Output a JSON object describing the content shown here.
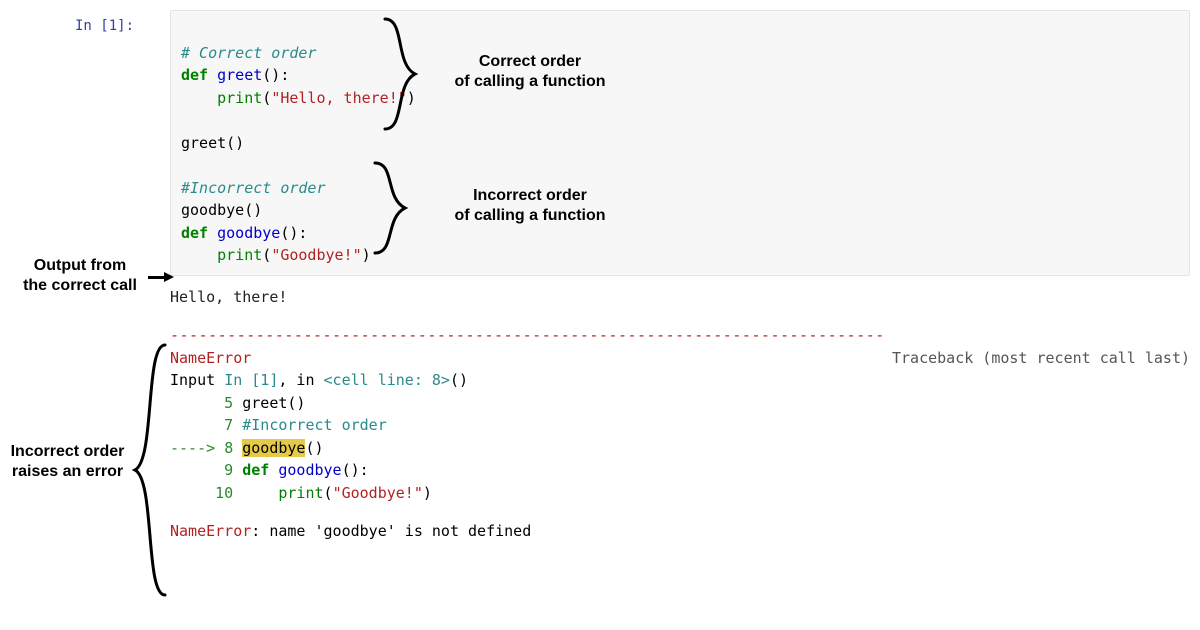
{
  "prompt": "In [1]:",
  "code": {
    "l1_comment": "# Correct order",
    "l2_kw": "def",
    "l2_fn": "greet",
    "l2_rest": "():",
    "l3_indent": "    ",
    "l3_builtin": "print",
    "l3_open": "(",
    "l3_str": "\"Hello, there!\"",
    "l3_close": ")",
    "l4": "",
    "l5": "greet()",
    "l6": "",
    "l7_comment": "#Incorrect order",
    "l8": "goodbye()",
    "l9_kw": "def",
    "l9_fn": "goodbye",
    "l9_rest": "():",
    "l10_indent": "    ",
    "l10_builtin": "print",
    "l10_open": "(",
    "l10_str": "\"Goodbye!\"",
    "l10_close": ")"
  },
  "output_line": "Hello, there!",
  "dashline": "---------------------------------------------------------------------------",
  "err": {
    "name": "NameError",
    "trace_label": "Traceback (most recent call last)",
    "input_prefix": "Input ",
    "input_in": "In [1]",
    "input_mid": ", in ",
    "input_cell": "<cell line: 8>",
    "input_suffix": "()",
    "ln5_num": "      5 ",
    "ln5_txt": "greet()",
    "ln7_num": "      7 ",
    "ln7_txt": "#Incorrect order",
    "arrow": "----> ",
    "ln8_num": "8 ",
    "ln8_hi": "goodbye",
    "ln8_rest": "()",
    "ln9_num": "      9 ",
    "ln9_kw": "def",
    "ln9_sp": " ",
    "ln9_fn": "goodbye",
    "ln9_rest": "():",
    "ln10_num": "     10 ",
    "ln10_indent": "    ",
    "ln10_builtin": "print",
    "ln10_open": "(",
    "ln10_str": "\"Goodbye!\"",
    "ln10_close": ")",
    "final_prefix": "NameError",
    "final_rest": ": name 'goodbye' is not defined"
  },
  "ann": {
    "correct": "Correct order\nof calling a function",
    "incorrect": "Incorrect order\nof calling a function",
    "output": "Output from\nthe correct call",
    "raises": "Incorrect order\nraises an error"
  }
}
